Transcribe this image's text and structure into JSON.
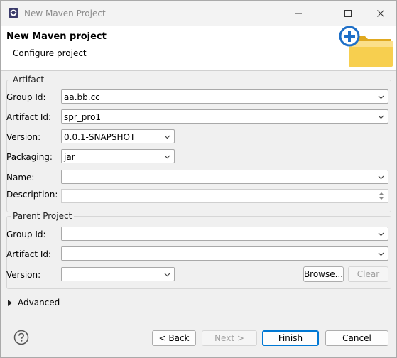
{
  "window": {
    "title": "New Maven Project",
    "icon": "eclipse-icon"
  },
  "banner": {
    "title": "New Maven Project",
    "heading": "New Maven project",
    "subtitle": "Configure project",
    "image": "folder-plus-icon"
  },
  "artifact": {
    "legend": "Artifact",
    "group_id": {
      "label": "Group Id:",
      "value": "aa.bb.cc"
    },
    "artifact_id": {
      "label": "Artifact Id:",
      "value": "spr_pro1"
    },
    "version": {
      "label": "Version:",
      "value": "0.0.1-SNAPSHOT"
    },
    "packaging": {
      "label": "Packaging:",
      "value": "jar"
    },
    "name": {
      "label": "Name:",
      "value": ""
    },
    "description": {
      "label": "Description:",
      "value": ""
    }
  },
  "parent": {
    "legend": "Parent Project",
    "group_id": {
      "label": "Group Id:",
      "value": ""
    },
    "artifact_id": {
      "label": "Artifact Id:",
      "value": ""
    },
    "version": {
      "label": "Version:",
      "value": ""
    },
    "browse_label": "Browse...",
    "clear_label": "Clear"
  },
  "advanced": {
    "label": "Advanced"
  },
  "buttons": {
    "back": "< Back",
    "next": "Next >",
    "finish": "Finish",
    "cancel": "Cancel"
  },
  "colors": {
    "accent": "#0078d4",
    "folder": "#f5c542",
    "plus": "#1e6fc7"
  }
}
